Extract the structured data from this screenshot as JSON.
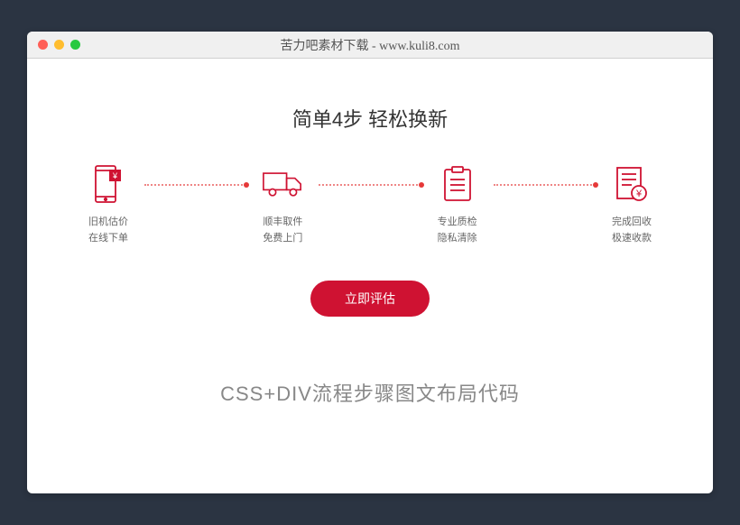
{
  "window": {
    "title": "苦力吧素材下载 - www.kuli8.com"
  },
  "heading": "简单4步 轻松换新",
  "steps": [
    {
      "line1": "旧机估价",
      "line2": "在线下单"
    },
    {
      "line1": "顺丰取件",
      "line2": "免费上门"
    },
    {
      "line1": "专业质检",
      "line2": "隐私清除"
    },
    {
      "line1": "完成回收",
      "line2": "极速收款"
    }
  ],
  "button": "立即评估",
  "caption": "CSS+DIV流程步骤图文布局代码",
  "accent": "#cf1232"
}
